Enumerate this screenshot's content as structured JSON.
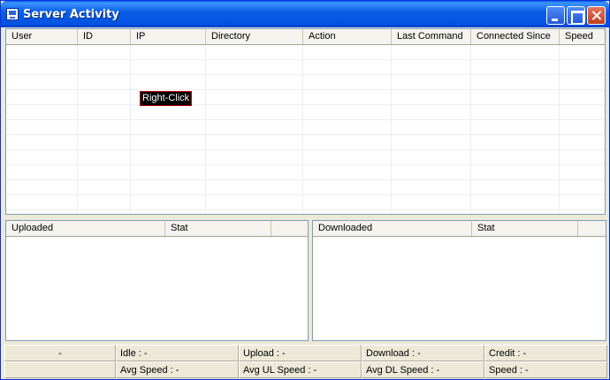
{
  "window": {
    "title": "Server Activity"
  },
  "main_list": {
    "columns": [
      "User",
      "ID",
      "IP",
      "Directory",
      "Action",
      "Last Command",
      "Connected Since",
      "Speed"
    ],
    "tooltip": "Right-Click"
  },
  "uploaded_list": {
    "columns": [
      "Uploaded",
      "Stat",
      ""
    ]
  },
  "downloaded_list": {
    "columns": [
      "Downloaded",
      "Stat",
      ""
    ]
  },
  "statusbar": {
    "row1": [
      "-",
      "Idle : -",
      "Upload : -",
      "Download : -",
      "Credit : -"
    ],
    "row2": [
      "",
      "Avg Speed : -",
      "Avg UL Speed : -",
      "Avg DL Speed : -",
      "Speed : -"
    ]
  },
  "colors": {
    "titlebar": "#0a5fe8",
    "window_bg": "#ece9d8",
    "tooltip_border": "#c00000"
  }
}
